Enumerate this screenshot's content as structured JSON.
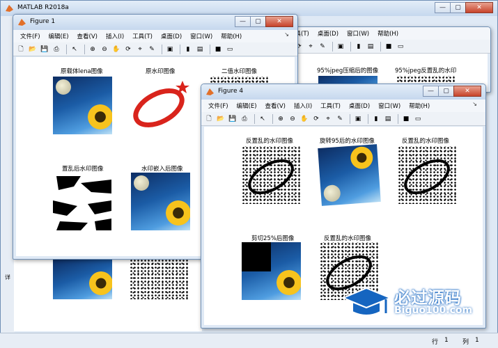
{
  "main_window": {
    "title": "MATLAB R2018a",
    "status": {
      "row_label": "行",
      "row_value": "1",
      "col_label": "列",
      "col_value": "1"
    },
    "left_marker": "详"
  },
  "menu": [
    "文件(F)",
    "编辑(E)",
    "查看(V)",
    "插入(I)",
    "工具(T)",
    "桌面(D)",
    "窗口(W)",
    "帮助(H)"
  ],
  "window_buttons": {
    "minimize": "—",
    "maximize": "▢",
    "close": "✕"
  },
  "figure1": {
    "title": "Figure 1",
    "plots": [
      "原载体lena图像",
      "原水印图像",
      "二值水印图像",
      "置乱后水印图像",
      "水印嵌入后图像"
    ]
  },
  "figure_behind": {
    "plots": [
      "95%jpeg压缩后的图像",
      "95%jpeg反置乱的水印"
    ]
  },
  "figure4": {
    "title": "Figure 4",
    "plots": [
      "反置乱的水印图像",
      "旋转95后的水印图像",
      "反置乱的水印图像",
      "剪切25%后图像",
      "反置乱的水印图像"
    ]
  },
  "watermark_logo": {
    "chinese": "必过源码",
    "url": "Biguo100.com"
  },
  "colors": {
    "titlebar": "#c6d8ee",
    "accent_red": "#d9241c",
    "logo_blue": "#1565c0"
  },
  "icons": [
    "new-file-icon",
    "open-folder-icon",
    "save-icon",
    "print-icon",
    "pointer-icon",
    "zoom-in-icon",
    "zoom-out-icon",
    "pan-icon",
    "rotate-icon",
    "data-cursor-icon",
    "brush-icon",
    "link-icon",
    "colorbar-icon",
    "legend-icon",
    "hide-tools-icon",
    "dock-icon"
  ]
}
